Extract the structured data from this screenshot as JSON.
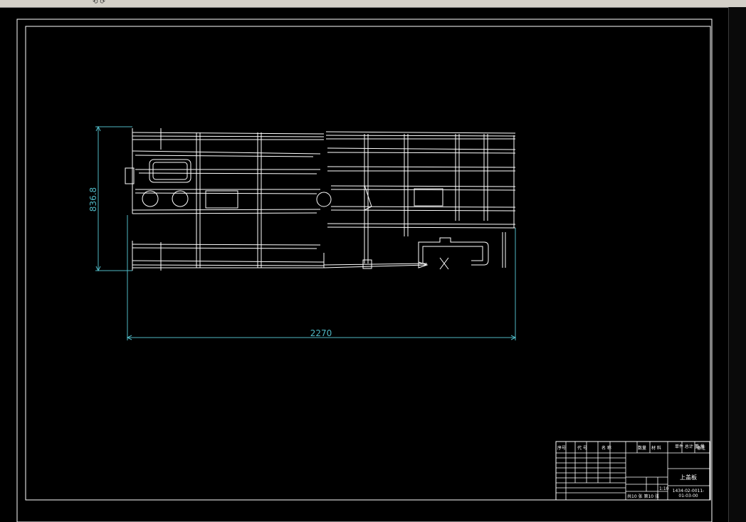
{
  "window": {
    "toolbar_icons": "⟲ ⟳"
  },
  "drawing": {
    "dimension_height": "836.8",
    "dimension_width": "2270"
  },
  "title_block": {
    "header": [
      "序号",
      "代  号",
      "名  称",
      "数量",
      "材  料",
      "单件 总计\n重 量",
      "备注"
    ],
    "part_name": "上盖板",
    "drawing_number_line1": "1434-02-0011-",
    "drawing_number_line2": "01-03-00",
    "scale": "1:10",
    "sheet_info": "共10 张  第10 张"
  },
  "colors": {
    "background": "#000000",
    "lines": "#ffffff",
    "dimension": "#4fb8c4"
  }
}
